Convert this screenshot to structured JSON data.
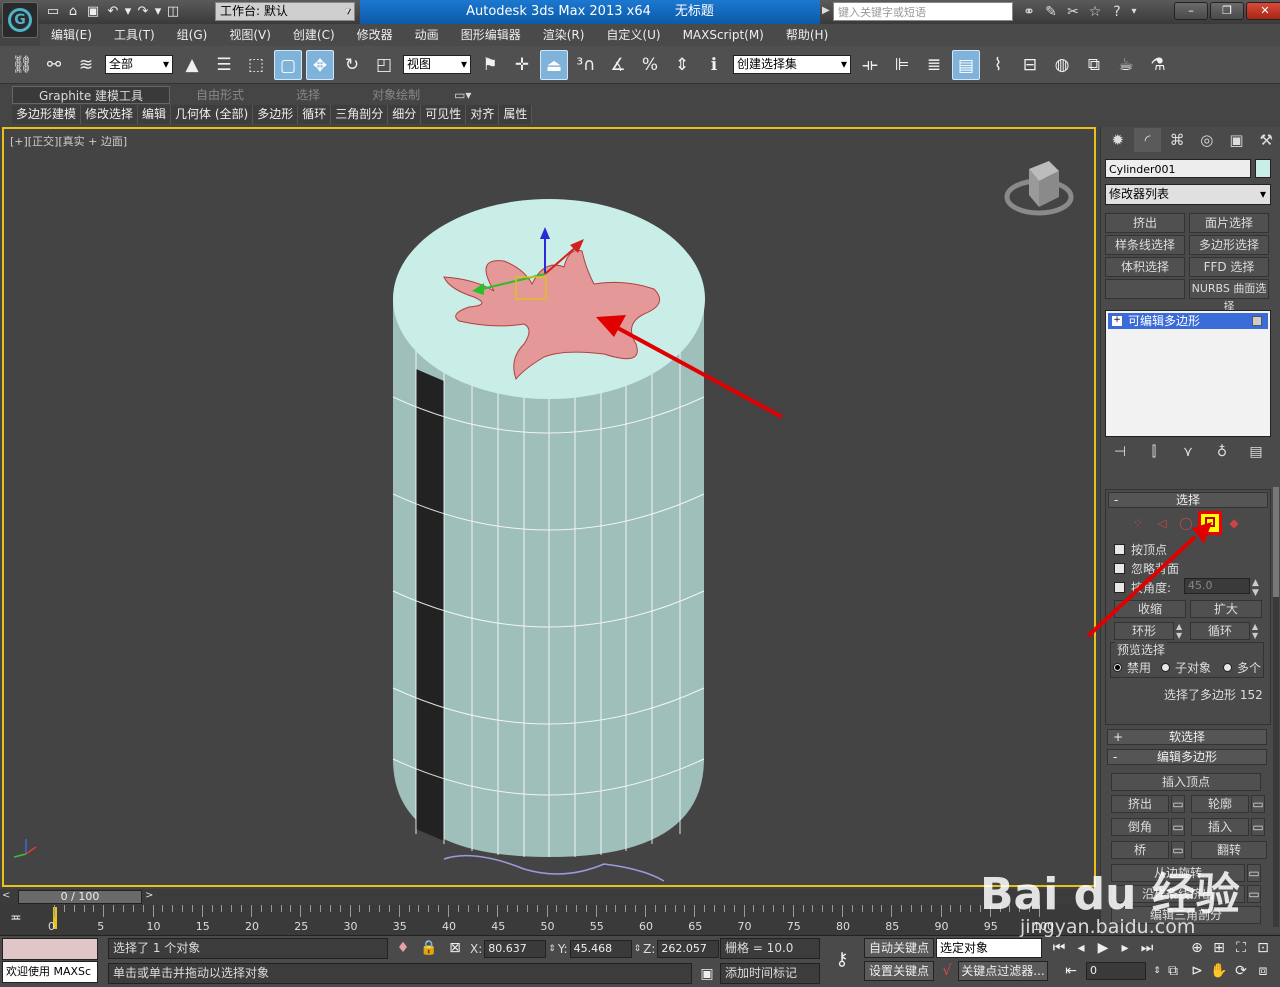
{
  "title_bar": {
    "workspace_label": "工作台: 默认",
    "app_title": "Autodesk 3ds Max  2013 x64",
    "doc_title": "无标题",
    "search_placeholder": "键入关键字或短语"
  },
  "menu": [
    "编辑(E)",
    "工具(T)",
    "组(G)",
    "视图(V)",
    "创建(C)",
    "修改器",
    "动画",
    "图形编辑器",
    "渲染(R)",
    "自定义(U)",
    "MAXScript(M)",
    "帮助(H)"
  ],
  "toolbar": {
    "selection_filter": "全部",
    "ref_coord": "视图",
    "named_selection": "创建选择集"
  },
  "ribbon": {
    "tabs": [
      "Graphite 建模工具",
      "自由形式",
      "选择",
      "对象绘制"
    ],
    "sub_items": [
      "多边形建模",
      "修改选择",
      "编辑",
      "几何体 (全部)",
      "多边形",
      "循环",
      "三角剖分",
      "细分",
      "可见性",
      "对齐",
      "属性"
    ]
  },
  "viewport": {
    "label": "[+][正交][真实 + 边面]"
  },
  "command_panel": {
    "object_name": "Cylinder001",
    "object_color": "#c9eee8",
    "modifier_list": "修改器列表",
    "modifier_buttons": [
      "挤出",
      "面片选择",
      "样条线选择",
      "多边形选择",
      "体积选择",
      "FFD 选择",
      "",
      "NURBS 曲面选择"
    ],
    "stack_item": "可编辑多边形",
    "selection_rollout": {
      "title": "选择",
      "by_vertex": "按顶点",
      "ignore_backfacing": "忽略背面",
      "by_angle": "按角度:",
      "angle_value": "45.0",
      "shrink": "收缩",
      "grow": "扩大",
      "ring": "环形",
      "loop": "循环",
      "preview_title": "预览选择",
      "preview_options": [
        "禁用",
        "子对象",
        "多个"
      ],
      "status": "选择了多边形 152"
    },
    "soft_selection_title": "软选择",
    "edit_poly_title": "编辑多边形",
    "insert_vertex": "插入顶点",
    "edit_poly_buttons": [
      "挤出",
      "轮廓",
      "倒角",
      "插入",
      "桥",
      "翻转"
    ],
    "hinge_from_edge": "从边旋转",
    "extrude_along_spline": "沿样条线挤出",
    "edit_triangulation": "编辑三角剖分"
  },
  "time_slider": {
    "position": "0 / 100"
  },
  "track_ticks": [
    "0",
    "5",
    "10",
    "15",
    "20",
    "25",
    "30",
    "35",
    "40",
    "45",
    "50",
    "55",
    "60",
    "65",
    "70",
    "75",
    "80",
    "85",
    "90",
    "95",
    "100"
  ],
  "status_bar": {
    "maxscript_text": "欢迎使用 MAXSc",
    "selected_count": "选择了 1 个对象",
    "prompt": "单击或单击并拖动以选择对象",
    "x_label": "X:",
    "x_value": "80.637",
    "y_label": "Y:",
    "y_value": "45.468",
    "z_label": "Z:",
    "z_value": "262.057",
    "grid": "栅格 = 10.0",
    "add_time_tag": "添加时间标记",
    "auto_key": "自动关键点",
    "set_key": "设置关键点",
    "selected_object": "选定对象",
    "key_filters": "关键点过滤器...",
    "frame": "0"
  },
  "watermark": {
    "brand": "Bai du 经验",
    "url": "jingyan.baidu.com"
  },
  "colors": {
    "viewport_border": "#e8c21a",
    "title_blue": "#1b78d0",
    "cylinder": "#9fbfbb",
    "cylinder_top": "#c9eee8",
    "hand": "#e49898",
    "annotation_arrow": "#e00000"
  }
}
